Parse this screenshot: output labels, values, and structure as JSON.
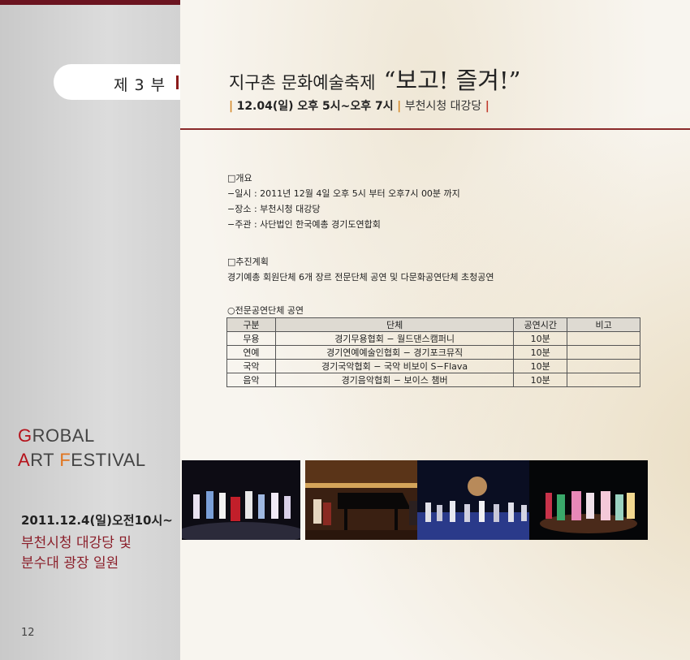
{
  "sidebar": {
    "part": "제 3 부",
    "festival_line1": {
      "first": "G",
      "rest": "ROBAL"
    },
    "festival_line2": {
      "a": "A",
      "rt": "RT ",
      "f": "F",
      "estival": "ESTIVAL"
    },
    "date": "2011.12.4(일)오전10시~",
    "venue_line1": "부천시청 대강당 및",
    "venue_line2": "분수대 광장 일원",
    "page_number": "12"
  },
  "header": {
    "title_small": "지구촌 문화예술축제",
    "title_big": "“보고! 즐겨!”",
    "datetime": "12.04(일) 오후 5시~오후 7시",
    "place": "부천시청 대강당"
  },
  "overview": {
    "heading": "□개요",
    "lines": [
      "−일시 : 2011년 12월 4일 오후 5시 부터 오후7시 00분 까지",
      "−장소 : 부천시청 대강당",
      "−주관 : 사단법인 한국예총 경기도연합회"
    ]
  },
  "plan": {
    "heading": "□추진계획",
    "text": "경기예총 회원단체 6개 장르 전문단체 공연 및 다문화공연단체 초청공연"
  },
  "table": {
    "heading": "○전문공연단체 공연",
    "columns": [
      "구분",
      "단체",
      "공연시간",
      "비고"
    ],
    "rows": [
      [
        "무용",
        "경기무용협회 − 월드댄스캠퍼니",
        "10분",
        ""
      ],
      [
        "연예",
        "경기연예예술인협회 − 경기포크뮤직",
        "10분",
        ""
      ],
      [
        "국악",
        "경기국악협회 − 국악 비보이 S−Flava",
        "10분",
        ""
      ],
      [
        "음악",
        "경기음악협회 − 보이스 챔버",
        "10분",
        ""
      ]
    ]
  },
  "colors": {
    "accent_red": "#8b1a1a",
    "accent_orange": "#d58a2a",
    "venue_text": "#8b1f2a"
  }
}
